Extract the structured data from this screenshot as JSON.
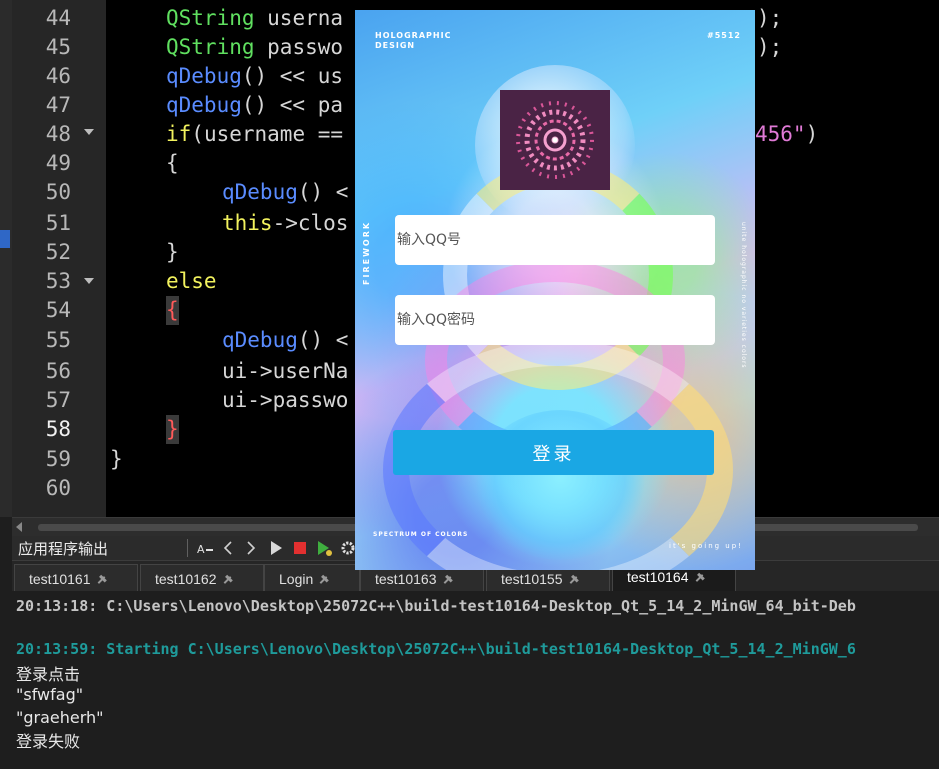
{
  "editor": {
    "line_numbers": [
      "44",
      "45",
      "46",
      "47",
      "48",
      "49",
      "50",
      "51",
      "52",
      "53",
      "54",
      "55",
      "56",
      "57",
      "58",
      "59",
      "60"
    ],
    "code": {
      "l44_type": "QString",
      "l44_rest": " userna",
      "l44_tail": ");",
      "l45_type": "QString",
      "l45_rest": " passwo",
      "l45_tail": ");",
      "l46_fn": "qDebug",
      "l46_rest": "() << us",
      "l47_fn": "qDebug",
      "l47_rest": "() << pa",
      "l48_kw": "if",
      "l48_rest": "(username ==",
      "l48_str": "456\"",
      "l48_tail": ")",
      "l49": "{",
      "l50_fn": "qDebug",
      "l50_rest": "() <",
      "l51_kw": "this",
      "l51_rest": "->clos",
      "l52": "}",
      "l53_kw": "else",
      "l54": "{",
      "l55_fn": "qDebug",
      "l55_rest": "() <",
      "l56": "ui->userNa",
      "l57": "ui->passwo",
      "l58": "}",
      "l59": "}"
    }
  },
  "output_toolbar": {
    "title": "应用程序输出",
    "icons": [
      "font-size-icon",
      "prev-icon",
      "next-icon",
      "run-icon",
      "stop-icon",
      "debug-run-icon",
      "settings-icon"
    ],
    "stop_color": "#e23030"
  },
  "tabs": [
    {
      "label": "test10161"
    },
    {
      "label": "test10162"
    },
    {
      "label": "Login"
    },
    {
      "label": "test10163"
    },
    {
      "label": "test10155"
    },
    {
      "label": "test10164",
      "active": true
    }
  ],
  "output": {
    "lines": [
      "20:13:18: C:\\Users\\Lenovo\\Desktop\\25072C++\\build-test10164-Desktop_Qt_5_14_2_MinGW_64_bit-Deb",
      "20:13:59: Starting C:\\Users\\Lenovo\\Desktop\\25072C++\\build-test10164-Desktop_Qt_5_14_2_MinGW_6",
      "登录点击",
      "\"sfwfag\"",
      "\"graeherh\"",
      "登录失败"
    ]
  },
  "login_window": {
    "header_left": "HOLOGRAPHIC DESIGN",
    "header_right": "#5512",
    "side_left": "FIREWORK",
    "side_right": "unite holographic no varieties colors",
    "footer_left": "SPECTRUM OF COLORS",
    "footer_right": "it's going up!",
    "username_placeholder": "输入QQ号",
    "password_placeholder": "输入QQ密码",
    "login_button": "登录",
    "accent": "#1aa7e4"
  }
}
